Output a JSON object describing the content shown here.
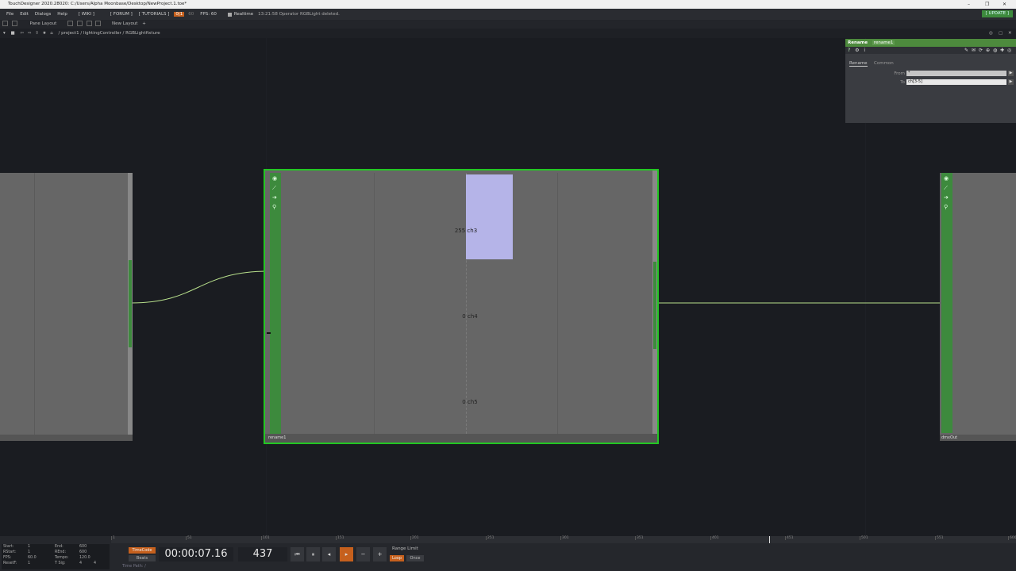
{
  "window": {
    "title": "TouchDesigner 2020.28020: C:/Users/Alpha Moonbase/Desktop/NewProject.1.toe*"
  },
  "menubar": {
    "items": [
      "File",
      "Edit",
      "Dialogs",
      "Help"
    ],
    "wiki": "[ WIKI ]",
    "forum": "[ FORUM ]",
    "tutorials": "[ TUTORIALS ]",
    "perf_badge": "0|1",
    "perf_count": "60",
    "fps": "FPS: 60",
    "realtime": "Realtime",
    "status": "13:21:58 Operator RGBLight deleted.",
    "update": "[ UPDATE ]"
  },
  "layoutbar": {
    "pane_layout": "Pane Layout",
    "new_layout": "New Layout"
  },
  "pathbar": {
    "path": "/ project1 / lightingController / RGBLightfixture"
  },
  "nodes": {
    "center": {
      "name": "rename1",
      "channels": [
        {
          "label": "255 ch3",
          "value": 255
        },
        {
          "label": "0 ch4",
          "value": 0
        },
        {
          "label": "0 ch5",
          "value": 0
        }
      ]
    },
    "right": {
      "name": "dmxOut"
    }
  },
  "panel": {
    "op_type": "Rename",
    "op_name": "rename1",
    "tabs": [
      "Rename",
      "Common"
    ],
    "params": [
      {
        "label": "From",
        "value": "*"
      },
      {
        "label": "To",
        "value": "ch[3-5]"
      }
    ]
  },
  "timeline": {
    "ticks": [
      "1",
      "51",
      "101",
      "151",
      "201",
      "251",
      "301",
      "351",
      "401",
      "451",
      "501",
      "551",
      "600"
    ],
    "timecode": "00:00:07.16",
    "frame": "437",
    "timecode_btn": "TimeCode",
    "beats_btn": "Beats",
    "range_limit": "Range Limit",
    "loop": "Loop",
    "once": "Once",
    "time_path": "Time Path: /",
    "stats": {
      "start": "1",
      "end": "600",
      "rstart": "1",
      "rend": "600",
      "fps": "60.0",
      "tempo": "120.0",
      "resetf": "1",
      "tsig1": "4",
      "tsig2": "4"
    },
    "stat_labels": {
      "start": "Start:",
      "end": "End:",
      "rstart": "RStart:",
      "rend": "REnd:",
      "fps": "FPS:",
      "tempo": "Tempo:",
      "resetf": "ResetF:",
      "tsig": "T Sig:"
    }
  },
  "colors": {
    "accent_green": "#3d8a3d",
    "selection_green": "#23c623",
    "bar_fill": "#b5b4e8",
    "wire": "#b8e08c"
  }
}
